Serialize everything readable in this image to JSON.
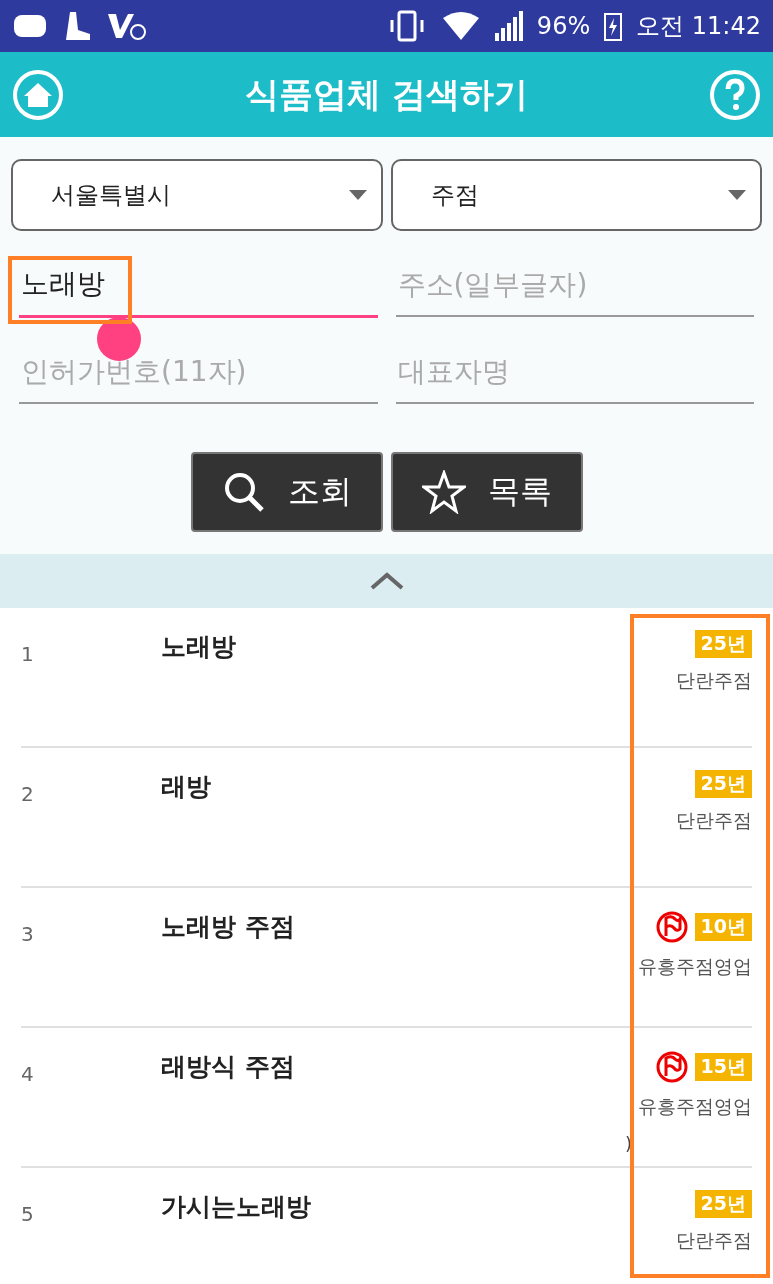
{
  "status_bar": {
    "battery": "96%",
    "time": "오전 11:42"
  },
  "header": {
    "title": "식품업체 검색하기"
  },
  "filters": [
    {
      "value": "서울특별시"
    },
    {
      "value": "주점"
    }
  ],
  "fields": [
    {
      "value": "노래방",
      "focused": true
    },
    {
      "placeholder": "주소(일부글자)",
      "focused": false
    },
    {
      "placeholder": "인허가번호(11자)",
      "focused": false
    },
    {
      "placeholder": "대표자명",
      "focused": false
    }
  ],
  "buttons": [
    {
      "kind": "search",
      "label": "조회"
    },
    {
      "kind": "star",
      "label": "목록"
    }
  ],
  "results": [
    {
      "number": "1",
      "name": "노래방",
      "years": "25년",
      "flagged": false,
      "category": "단란주점"
    },
    {
      "number": "2",
      "name": "래방",
      "years": "25년",
      "flagged": false,
      "category": "단란주점"
    },
    {
      "number": "3",
      "name": "노래방 주점",
      "years": "10년",
      "flagged": true,
      "category": "유흥주점영업"
    },
    {
      "number": "4",
      "name": "래방식 주점",
      "years": "15년",
      "flagged": true,
      "category": "유흥주점영업",
      "note": ")"
    },
    {
      "number": "5",
      "name": "가시는노래방",
      "years": "25년",
      "flagged": false,
      "category": "단란주점"
    }
  ]
}
